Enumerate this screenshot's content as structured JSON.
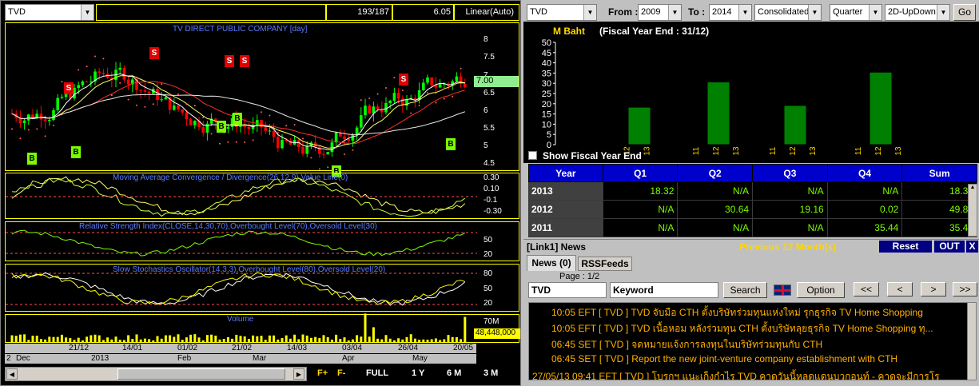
{
  "left": {
    "symbol": "TVD",
    "bars_info": "193/187",
    "price": "6.05",
    "scale": "Linear(Auto)",
    "chart_title": "TV DIRECT PUBLIC COMPANY [day]",
    "price_axis": [
      "8",
      "7.5",
      "7",
      "6.5",
      "6",
      "5.5",
      "5",
      "4.5"
    ],
    "last_price_tag": "7.00",
    "macd_title": "Moving Average Convergence / Divergence(26,12,9),Value Line(0)",
    "macd_axis": [
      "0.30",
      "0.10",
      "-0.1",
      "-0.30"
    ],
    "rsi_title": "Relative Strength Index(CLOSE,14,30,70),Overbought Level(70),Oversold Level(30)",
    "rsi_axis": [
      "50",
      "20"
    ],
    "sto_title": "Slow Stochastics Oscillator(14,3,3),Overbought Level(80),Oversold Level(20)",
    "sto_axis": [
      "80",
      "50",
      "20"
    ],
    "vol_title": "Volume",
    "vol_axis": "70M",
    "vol_tag": "48,448,000",
    "dates": [
      "21/12",
      "14/01",
      "01/02",
      "21/02",
      "14/03",
      "03/04",
      "26/04",
      "20/05"
    ],
    "months": [
      "Dec",
      "2013",
      "Feb",
      "Mar",
      "Apr",
      "May"
    ],
    "year_corner": "2",
    "buttons": {
      "fplus": "F+",
      "fminus": "F-",
      "full": "FULL",
      "y1": "1 Y",
      "m6": "6 M",
      "m3": "3 M"
    },
    "signals": {
      "s": "S",
      "b": "B"
    }
  },
  "right": {
    "symbol": "TVD",
    "from_label": "From :",
    "from_year": "2009",
    "to_label": "To :",
    "to_year": "2014",
    "statement": "Consolidated",
    "period": "Quarter",
    "view": "2D-UpDown",
    "go": "Go",
    "unit_label": "M Baht",
    "fiscal_label": "(Fiscal Year End : 31/12)",
    "show_fye": "Show Fiscal Year End",
    "table_headers": [
      "Year",
      "Q1",
      "Q2",
      "Q3",
      "Q4",
      "Sum"
    ],
    "table_rows": [
      {
        "year": "2013",
        "q1": "18.32",
        "q2": "N/A",
        "q3": "N/A",
        "q4": "N/A",
        "sum": "18.32"
      },
      {
        "year": "2012",
        "q1": "N/A",
        "q2": "30.64",
        "q3": "19.16",
        "q4": "0.02",
        "sum": "49.82"
      },
      {
        "year": "2011",
        "q1": "N/A",
        "q2": "N/A",
        "q3": "N/A",
        "q4": "35.44",
        "sum": "35.44"
      }
    ],
    "news_header": "[Link1] News",
    "previous": "Previous 12 Month(s)",
    "reset": "Reset",
    "out": "OUT",
    "close": "X",
    "tab_news": "News (0)",
    "tab_rss": "RSSFeeds",
    "page": "Page : 1/2",
    "news_symbol": "TVD",
    "keyword": "Keyword",
    "search": "Search",
    "option": "Option",
    "nav": [
      "<<",
      "<",
      ">",
      ">>"
    ],
    "news": [
      "10:05  EFT  [ TVD ]  TVD จับมือ CTH ตั้งบริษัทร่วมทุนแห่งใหม่ รุกธุรกิจ TV Home Shopping",
      "10:05  EFT  [ TVD ]  TVD เนื้อหอม หลังร่วมทุน CTH ตั้งบริษัทลุยธุรกิจ TV Home Shopping ทุ...",
      "06:45  SET  [ TVD ]  จดหมายแจ้งการลงทุนในบริษัทร่วมทุนกับ CTH",
      "06:45  SET  [ TVD ]  Report the new joint-venture company establishment with CTH",
      "27/05/13 09:41  EFT  [ TVD ]  โบรกฯ แนะเก็งกำไร TVD คาดวันนี้หลุดแดนบวกอนท์ - คาดจะมีการโร"
    ]
  },
  "chart_data": {
    "type": "bar",
    "title": "M Baht",
    "subtitle": "(Fiscal Year End : 31/12)",
    "ylim": [
      0,
      50
    ],
    "yticks": [
      0,
      5,
      10,
      15,
      20,
      25,
      30,
      35,
      40,
      45,
      50
    ],
    "grid": false,
    "groups": [
      {
        "year": "2013",
        "categories": [
          "12",
          "13"
        ],
        "bars": [
          {
            "label": "13",
            "value": 18.32
          }
        ]
      },
      {
        "year": "2012",
        "categories": [
          "11",
          "12",
          "13"
        ],
        "bars": [
          {
            "label": "12",
            "value": 30.64
          }
        ]
      },
      {
        "year": "2012",
        "categories": [
          "11",
          "12",
          "13"
        ],
        "bars": [
          {
            "label": "12",
            "value": 19.16
          }
        ]
      },
      {
        "year": "2011",
        "categories": [
          "11",
          "12",
          "13"
        ],
        "bars": [
          {
            "label": "11",
            "value": 35.44
          }
        ]
      }
    ],
    "bar_color": "#008000"
  },
  "colors": {
    "accent": "#0000cc",
    "panel": "#000000",
    "up": "#00ff00",
    "down": "#ff0000",
    "border": "#ffff00"
  }
}
